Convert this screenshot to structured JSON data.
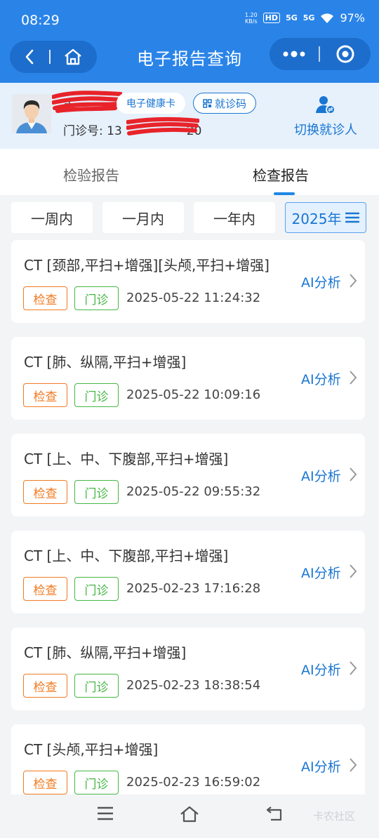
{
  "status_bar": {
    "time": "08:29",
    "net_speed_top": "1.20",
    "net_speed_unit": "KB/s",
    "hd": "HD",
    "signal1": "5G",
    "signal2": "5G",
    "battery": "97%"
  },
  "header": {
    "title": "电子报告查询"
  },
  "patient": {
    "name_partial": "吉",
    "health_card_label": "电子健康卡",
    "visit_code_label": "就诊码",
    "clinic_prefix": "门诊号: 13",
    "clinic_suffix": "20",
    "switch_label": "切换就诊人"
  },
  "tabs": [
    {
      "label": "检验报告"
    },
    {
      "label": "检查报告"
    }
  ],
  "filters": {
    "week": "一周内",
    "month": "一月内",
    "year": "一年内",
    "selected_year": "2025年"
  },
  "reports": [
    {
      "title": "CT [颈部,平扫+增强][头颅,平扫+增强]",
      "tag_type": "检查",
      "tag_dept": "门诊",
      "time": "2025-05-22 11:24:32",
      "action": "AI分析"
    },
    {
      "title": "CT [肺、纵隔,平扫+增强]",
      "tag_type": "检查",
      "tag_dept": "门诊",
      "time": "2025-05-22 10:09:16",
      "action": "AI分析"
    },
    {
      "title": "CT [上、中、下腹部,平扫+增强]",
      "tag_type": "检查",
      "tag_dept": "门诊",
      "time": "2025-05-22 09:55:32",
      "action": "AI分析"
    },
    {
      "title": "CT [上、中、下腹部,平扫+增强]",
      "tag_type": "检查",
      "tag_dept": "门诊",
      "time": "2025-02-23 17:16:28",
      "action": "AI分析"
    },
    {
      "title": "CT [肺、纵隔,平扫+增强]",
      "tag_type": "检查",
      "tag_dept": "门诊",
      "time": "2025-02-23 18:38:54",
      "action": "AI分析"
    },
    {
      "title": "CT [头颅,平扫+增强]",
      "tag_type": "检查",
      "tag_dept": "门诊",
      "time": "2025-02-23 16:59:02",
      "action": "AI分析"
    }
  ],
  "watermark": "卡农社区",
  "colors": {
    "primary": "#2a84e8",
    "accent": "#1976d2",
    "tag_exam": "#f07b22",
    "tag_outpatient": "#46b744",
    "redaction": "#e8232a"
  },
  "icons": [
    "back-icon",
    "home-icon",
    "more-icon",
    "close-circle-icon",
    "qr-icon",
    "switch-user-icon",
    "chevron-right-icon",
    "list-icon",
    "menu-icon",
    "nav-home-icon",
    "nav-back-icon"
  ]
}
